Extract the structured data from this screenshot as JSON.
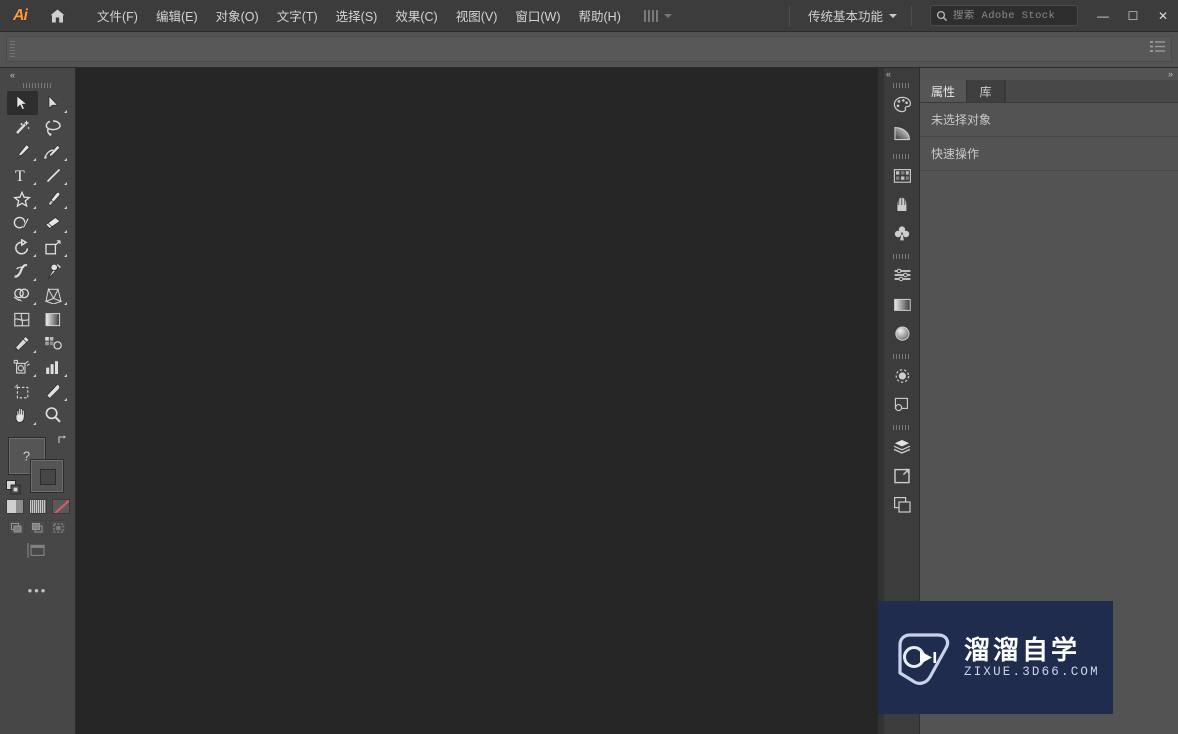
{
  "app": {
    "name": "Adobe Illustrator",
    "logo_text": "Ai",
    "home_icon": "home-icon"
  },
  "menubar": {
    "items": [
      {
        "label": "文件(F)",
        "name": "menu-file"
      },
      {
        "label": "编辑(E)",
        "name": "menu-edit"
      },
      {
        "label": "对象(O)",
        "name": "menu-object"
      },
      {
        "label": "文字(T)",
        "name": "menu-type"
      },
      {
        "label": "选择(S)",
        "name": "menu-select"
      },
      {
        "label": "效果(C)",
        "name": "menu-effect"
      },
      {
        "label": "视图(V)",
        "name": "menu-view"
      },
      {
        "label": "窗口(W)",
        "name": "menu-window"
      },
      {
        "label": "帮助(H)",
        "name": "menu-help"
      }
    ],
    "workspace": {
      "label": "传统基本功能",
      "chevron_icon": "chevron-down-icon"
    },
    "search": {
      "placeholder": "搜索 Adobe Stock",
      "value": "",
      "icon": "search-icon"
    },
    "window_controls": {
      "minimize": "—",
      "maximize": "☐",
      "close": "✕"
    }
  },
  "controlbar": {
    "grip_icon": "drag-grip-icon",
    "overflow_icon": "list-menu-icon"
  },
  "toolbar": {
    "collapse_icon": "double-chevron-left-icon",
    "grip_icon": "drag-grip-icon",
    "tools": [
      {
        "name": "tool-selection",
        "icon": "selection-arrow-icon",
        "active": true,
        "flyout": false
      },
      {
        "name": "tool-direct-selection",
        "icon": "direct-selection-icon",
        "active": false,
        "flyout": true
      },
      {
        "name": "tool-magic-wand",
        "icon": "magic-wand-icon",
        "active": false,
        "flyout": false
      },
      {
        "name": "tool-lasso",
        "icon": "lasso-icon",
        "active": false,
        "flyout": false
      },
      {
        "name": "tool-pen",
        "icon": "pen-icon",
        "active": false,
        "flyout": true
      },
      {
        "name": "tool-curvature",
        "icon": "curvature-icon",
        "active": false,
        "flyout": true
      },
      {
        "name": "tool-type",
        "icon": "type-icon",
        "active": false,
        "flyout": true
      },
      {
        "name": "tool-line-segment",
        "icon": "line-segment-icon",
        "active": false,
        "flyout": true
      },
      {
        "name": "tool-shape",
        "icon": "star-shape-icon",
        "active": false,
        "flyout": true
      },
      {
        "name": "tool-paintbrush",
        "icon": "paintbrush-icon",
        "active": false,
        "flyout": true
      },
      {
        "name": "tool-shaper",
        "icon": "shaper-pencil-icon",
        "active": false,
        "flyout": true
      },
      {
        "name": "tool-eraser",
        "icon": "eraser-icon",
        "active": false,
        "flyout": true
      },
      {
        "name": "tool-rotate",
        "icon": "rotate-icon",
        "active": false,
        "flyout": true
      },
      {
        "name": "tool-scale",
        "icon": "scale-icon",
        "active": false,
        "flyout": true
      },
      {
        "name": "tool-width",
        "icon": "width-icon",
        "active": false,
        "flyout": true
      },
      {
        "name": "tool-free-transform",
        "icon": "free-transform-pin-icon",
        "active": false,
        "flyout": false
      },
      {
        "name": "tool-shape-builder",
        "icon": "shape-builder-icon",
        "active": false,
        "flyout": true
      },
      {
        "name": "tool-perspective-grid",
        "icon": "perspective-grid-icon",
        "active": false,
        "flyout": true
      },
      {
        "name": "tool-mesh",
        "icon": "mesh-icon",
        "active": false,
        "flyout": false
      },
      {
        "name": "tool-gradient",
        "icon": "gradient-icon",
        "active": false,
        "flyout": false
      },
      {
        "name": "tool-eyedropper",
        "icon": "eyedropper-icon",
        "active": false,
        "flyout": true
      },
      {
        "name": "tool-blend",
        "icon": "blend-icon",
        "active": false,
        "flyout": false
      },
      {
        "name": "tool-symbol-sprayer",
        "icon": "symbol-sprayer-icon",
        "active": false,
        "flyout": true
      },
      {
        "name": "tool-column-graph",
        "icon": "column-graph-icon",
        "active": false,
        "flyout": true
      },
      {
        "name": "tool-artboard",
        "icon": "artboard-icon",
        "active": false,
        "flyout": false
      },
      {
        "name": "tool-slice",
        "icon": "slice-knife-icon",
        "active": false,
        "flyout": true
      },
      {
        "name": "tool-hand",
        "icon": "hand-icon",
        "active": false,
        "flyout": true
      },
      {
        "name": "tool-zoom",
        "icon": "zoom-magnifier-icon",
        "active": false,
        "flyout": false
      }
    ],
    "fill_stroke": {
      "fill_name": "fill-swatch",
      "stroke_name": "stroke-swatch",
      "swap_icon": "swap-fill-stroke-icon",
      "default_icon": "default-fill-stroke-icon",
      "question_glyph": "?"
    },
    "color_modes": [
      {
        "name": "mode-color",
        "icon": "solid-color-icon"
      },
      {
        "name": "mode-gradient",
        "icon": "gradient-swatch-icon"
      },
      {
        "name": "mode-none",
        "icon": "none-swatch-icon"
      }
    ],
    "draw_modes": [
      {
        "name": "draw-normal",
        "icon": "draw-normal-icon"
      },
      {
        "name": "draw-behind",
        "icon": "draw-behind-icon"
      },
      {
        "name": "draw-inside",
        "icon": "draw-inside-icon"
      }
    ],
    "screen_mode": {
      "name": "screen-mode-button",
      "icon": "screen-mode-icon"
    },
    "more_tools": {
      "name": "edit-toolbar-button",
      "label": "•••"
    }
  },
  "rail": {
    "collapse_icon": "double-chevron-left-icon",
    "buttons": [
      {
        "name": "rail-color",
        "icon": "color-palette-icon"
      },
      {
        "name": "rail-gradient",
        "icon": "gradient-quarter-icon"
      },
      {
        "name": "rail-swatches",
        "icon": "swatches-icon"
      },
      {
        "name": "rail-brushes",
        "icon": "brushes-icon"
      },
      {
        "name": "rail-symbols",
        "icon": "symbols-clover-icon"
      },
      {
        "name": "rail-align",
        "icon": "align-lines-icon"
      },
      {
        "name": "rail-transform",
        "icon": "transform-gradient-icon"
      },
      {
        "name": "rail-appearance",
        "icon": "appearance-sphere-icon"
      },
      {
        "name": "rail-transparency",
        "icon": "transparency-icon"
      },
      {
        "name": "rail-pathfinder",
        "icon": "pathfinder-icon"
      },
      {
        "name": "rail-layers",
        "icon": "layers-stack-icon"
      },
      {
        "name": "rail-artboards",
        "icon": "artboards-icon"
      },
      {
        "name": "rail-asset-export",
        "icon": "asset-export-icon"
      }
    ]
  },
  "properties_panel": {
    "collapse_icon": "double-chevron-right-icon",
    "tabs": [
      {
        "label": "属性",
        "name": "tab-properties",
        "active": true
      },
      {
        "label": "库",
        "name": "tab-libraries",
        "active": false
      }
    ],
    "selection_status": "未选择对象",
    "quick_actions_label": "快速操作"
  },
  "watermark": {
    "title": "溜溜自学",
    "domain": "ZIXUE.3D66.COM",
    "logo_icon": "play-triangle-logo-icon",
    "bg_color": "#1f2c4e"
  },
  "colors": {
    "menubar_bg": "#3c3c3c",
    "controlbar_bg": "#535353",
    "toolpanel_bg": "#474747",
    "canvas_bg": "#262626",
    "panel_bg": "#535353",
    "rail_bg": "#3c3c3c",
    "tab_active_bg": "#565656",
    "accent_orange": "#ff9a3c",
    "watermark_blue": "#1f2c4e"
  }
}
